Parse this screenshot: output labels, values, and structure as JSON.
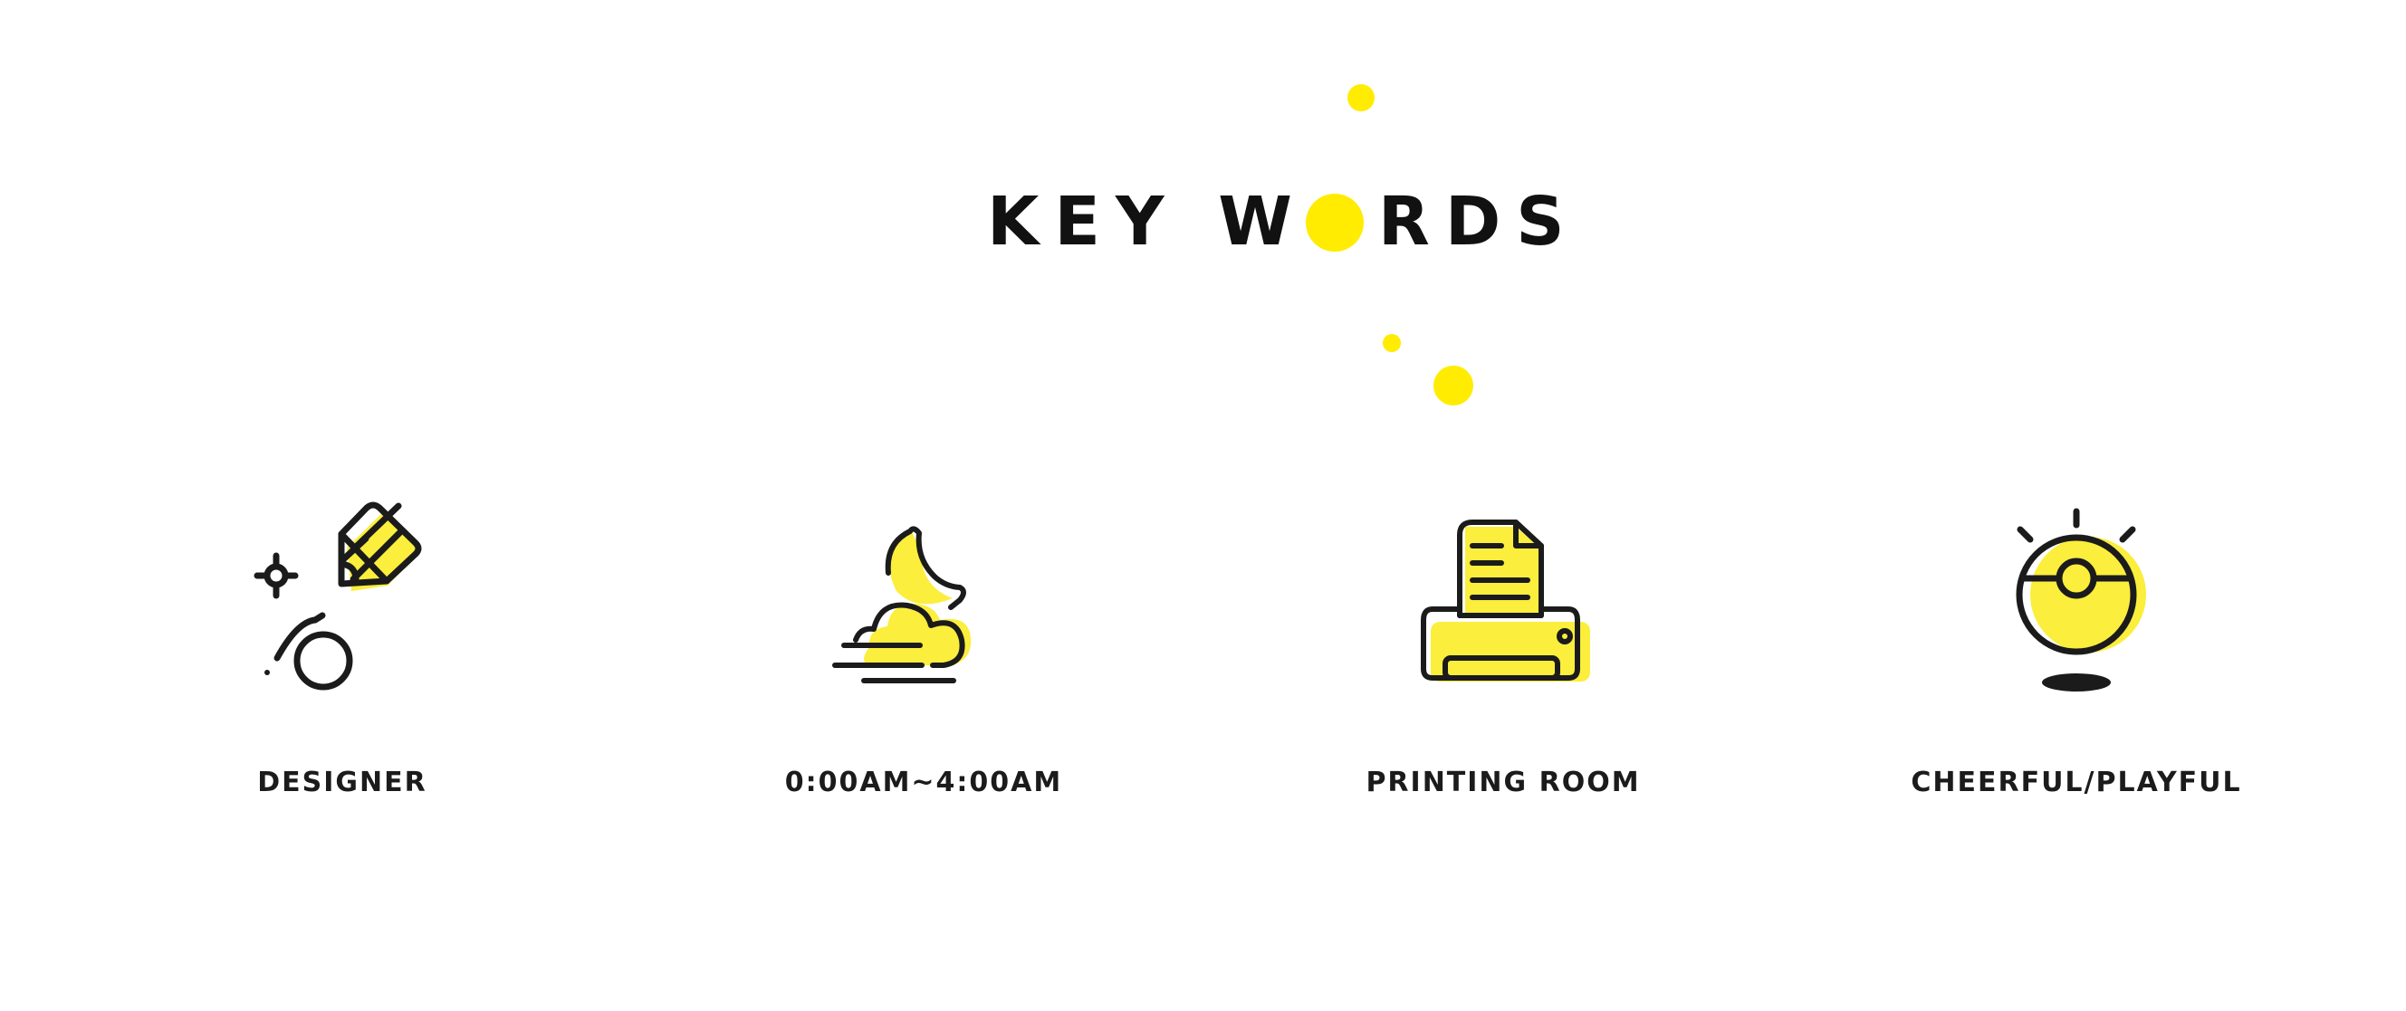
{
  "colors": {
    "accent": "#ffec00",
    "icon_fill": "#fbee3c",
    "ink": "#1b1b1b",
    "background": "#ffffff"
  },
  "title": {
    "part1": "KEY W",
    "part2": "RDS"
  },
  "keywords": [
    {
      "label": "DESIGNER",
      "icon": "pencil-designer-icon"
    },
    {
      "label": "0:00AM~4:00AM",
      "icon": "moon-cloud-icon"
    },
    {
      "label": "PRINTING ROOM",
      "icon": "printer-icon"
    },
    {
      "label": "CHEERFUL/PLAYFUL",
      "icon": "light-bulb-icon"
    }
  ]
}
